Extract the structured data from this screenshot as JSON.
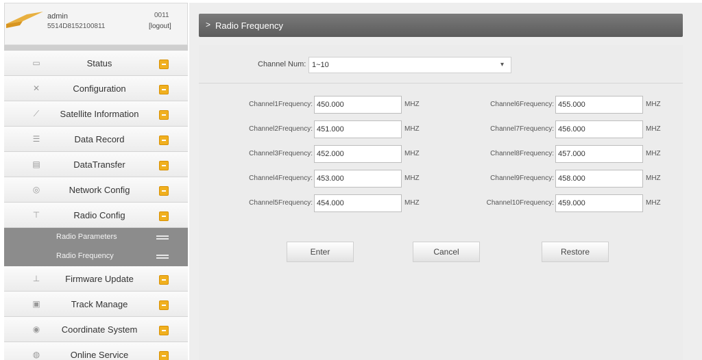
{
  "user": {
    "name": "admin",
    "id": "5514D8152100811",
    "code": "0011",
    "logout_label": "[logout]"
  },
  "menu": {
    "items": [
      {
        "label": "Status",
        "icon": "monitor-icon"
      },
      {
        "label": "Configuration",
        "icon": "tools-icon"
      },
      {
        "label": "Satellite Information",
        "icon": "satellite-icon"
      },
      {
        "label": "Data Record",
        "icon": "record-icon"
      },
      {
        "label": "DataTransfer",
        "icon": "transfer-icon"
      },
      {
        "label": "Network Config",
        "icon": "network-icon"
      },
      {
        "label": "Radio Config",
        "icon": "antenna-icon"
      }
    ],
    "radio_sub": [
      {
        "label": "Radio Parameters"
      },
      {
        "label": "Radio Frequency"
      }
    ],
    "items_after": [
      {
        "label": "Firmware Update",
        "icon": "upload-icon"
      },
      {
        "label": "Track Manage",
        "icon": "track-icon"
      },
      {
        "label": "Coordinate System",
        "icon": "globe-icon"
      },
      {
        "label": "Online Service",
        "icon": "service-icon"
      }
    ]
  },
  "page": {
    "title": "Radio Frequency",
    "channel_num_label": "Channel Num:",
    "channel_num_value": "1~10"
  },
  "channels": [
    {
      "label": "Channel1Frequency:",
      "value": "450.000",
      "unit": "MHZ"
    },
    {
      "label": "Channel2Frequency:",
      "value": "451.000",
      "unit": "MHZ"
    },
    {
      "label": "Channel3Frequency:",
      "value": "452.000",
      "unit": "MHZ"
    },
    {
      "label": "Channel4Frequency:",
      "value": "453.000",
      "unit": "MHZ"
    },
    {
      "label": "Channel5Frequency:",
      "value": "454.000",
      "unit": "MHZ"
    },
    {
      "label": "Channel6Frequency:",
      "value": "455.000",
      "unit": "MHZ"
    },
    {
      "label": "Channel7Frequency:",
      "value": "456.000",
      "unit": "MHZ"
    },
    {
      "label": "Channel8Frequency:",
      "value": "457.000",
      "unit": "MHZ"
    },
    {
      "label": "Channel9Frequency:",
      "value": "458.000",
      "unit": "MHZ"
    },
    {
      "label": "Channel10Frequency:",
      "value": "459.000",
      "unit": "MHZ"
    }
  ],
  "buttons": {
    "enter": "Enter",
    "cancel": "Cancel",
    "restore": "Restore"
  },
  "colors": {
    "badge": "#f0b020",
    "title_bar": "#6a6a6a",
    "submenu": "#8c8c8c"
  }
}
